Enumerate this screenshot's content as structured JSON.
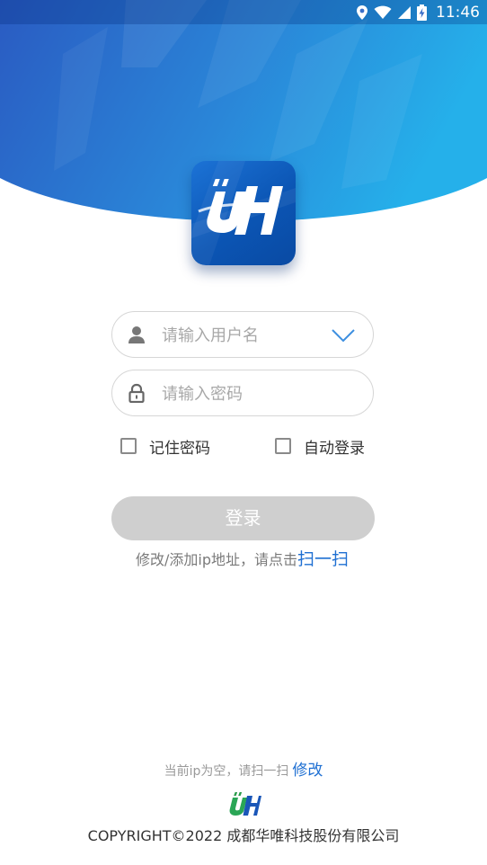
{
  "status_bar": {
    "time": "11:46",
    "icons": [
      "location-icon",
      "wifi-icon",
      "signal-icon",
      "battery-charging-icon"
    ]
  },
  "colors": {
    "header_start": "#2a5fc4",
    "header_end": "#25aeea",
    "accent_link": "#1e6fd2",
    "button_disabled": "#cfcfcf"
  },
  "login_form": {
    "username_placeholder": "请输入用户名",
    "password_placeholder": "请输入密码",
    "remember_password_label": "记住密码",
    "auto_login_label": "自动登录",
    "login_label": "登录",
    "ip_hint_text": "修改/添加ip地址，请点击",
    "scan_link": "扫一扫"
  },
  "footer": {
    "ip_status_text": "当前ip为空，请扫一扫",
    "modify_link": "修改",
    "copyright": "COPYRIGHT©2022 成都华唯科技股份有限公司"
  }
}
